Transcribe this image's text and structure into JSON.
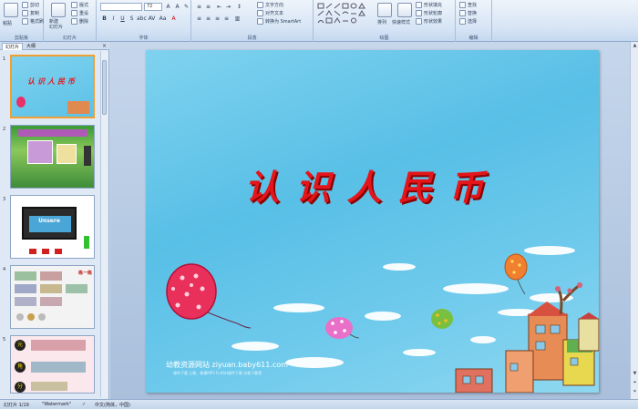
{
  "ribbon": {
    "clipboard": {
      "paste": "粘贴",
      "cut": "剪切",
      "copy": "复制",
      "format_painter": "格式刷",
      "label": "剪贴板"
    },
    "slides": {
      "new_slide": "新建\n幻灯片",
      "layout": "版式",
      "reset": "重设",
      "delete": "删除",
      "label": "幻灯片"
    },
    "font": {
      "size": "72",
      "label": "字体"
    },
    "paragraph": {
      "text_direction": "文字方向",
      "align_text": "对齐文本",
      "convert_smartart": "转换为 SmartArt",
      "label": "段落"
    },
    "drawing": {
      "arrange": "排列",
      "quick_styles": "快速样式",
      "shape_fill": "形状填充",
      "shape_outline": "形状轮廓",
      "shape_effects": "形状效果",
      "label": "绘图"
    },
    "editing": {
      "find": "查找",
      "replace": "替换",
      "select": "选择",
      "label": "编辑"
    }
  },
  "panel": {
    "tab_slides": "幻灯片",
    "tab_outline": "大纲",
    "close": "×"
  },
  "thumbnails": [
    {
      "num": "1",
      "title": "认识人民币"
    },
    {
      "num": "2"
    },
    {
      "num": "3",
      "caption": "Unsere"
    },
    {
      "num": "4",
      "tag": "练一练"
    },
    {
      "num": "5",
      "tags": [
        "元",
        "角",
        "分"
      ]
    }
  ],
  "slide": {
    "title": "认识人民币",
    "site_line": "幼教资源网站  ziyuan.baby611.com",
    "site_sub": "课件下载  儿歌、故事MP3  FLASH课件下载  试卷下载等"
  },
  "status": {
    "slide_count": "幻灯片 1/19",
    "theme": "\"Watermark\"",
    "language": "中文(简体，中国)"
  },
  "colors": {
    "title": "#e4161b",
    "sky": "#5cc1e7",
    "ribbon": "#d6e4f5"
  }
}
